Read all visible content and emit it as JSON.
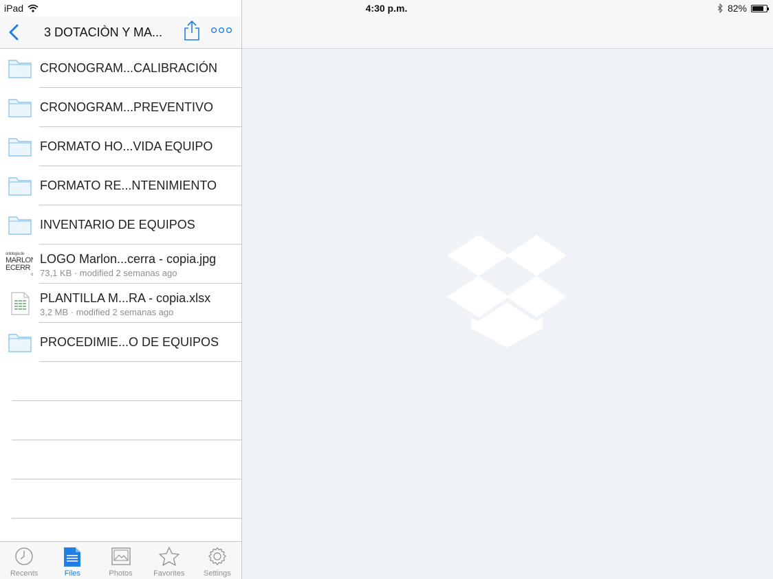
{
  "status_bar": {
    "device": "iPad",
    "time": "4:30 p.m.",
    "battery": "82%",
    "battery_level": 0.82
  },
  "nav": {
    "title": "3 DOTACIÒN Y MA..."
  },
  "rows": [
    {
      "type": "folder",
      "name": "CRONOGRAM...CALIBRACIÓN"
    },
    {
      "type": "folder",
      "name": "CRONOGRAM...PREVENTIVO"
    },
    {
      "type": "folder",
      "name": "FORMATO HO...VIDA EQUIPO"
    },
    {
      "type": "folder",
      "name": "FORMATO RE...NTENIMIENTO"
    },
    {
      "type": "folder",
      "name": "INVENTARIO DE EQUIPOS"
    },
    {
      "type": "image",
      "name": "LOGO Marlon...cerra - copia.jpg",
      "meta": "73,1 KB · modified 2 semanas ago",
      "thumb_lines": [
        "ontología de",
        "MARLON",
        "ECERR",
        "o"
      ]
    },
    {
      "type": "spreadsheet",
      "name": "PLANTILLA M...RA - copia.xlsx",
      "meta": "3,2 MB · modified 2 semanas ago"
    },
    {
      "type": "folder",
      "name": "PROCEDIMIE...O DE EQUIPOS"
    }
  ],
  "tabs": [
    {
      "label": "Recents",
      "icon": "clock-icon"
    },
    {
      "label": "Files",
      "icon": "file-icon",
      "active": true
    },
    {
      "label": "Photos",
      "icon": "photo-icon"
    },
    {
      "label": "Favorites",
      "icon": "star-icon"
    },
    {
      "label": "Settings",
      "icon": "gear-icon"
    }
  ],
  "colors": {
    "accent": "#1e7fe6",
    "detail_bg": "#eff2f6",
    "folder": "#8fc6ee"
  }
}
